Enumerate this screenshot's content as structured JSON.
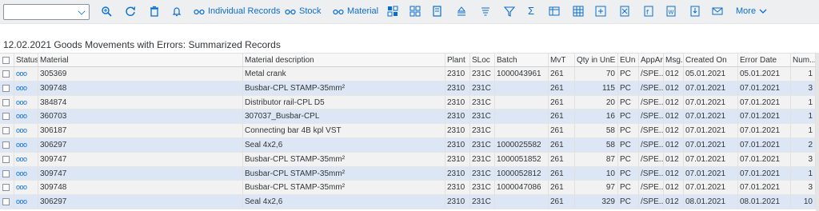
{
  "toolbar": {
    "variant_value": "",
    "individual_records": "Individual Records",
    "stock": "Stock",
    "material": "Material",
    "more": "More"
  },
  "title": "12.02.2021 Goods Movements with Errors: Summarized Records",
  "columns": [
    "Status",
    "Material",
    "Material description",
    "Plant",
    "SLoc",
    "Batch",
    "MvT",
    "Qty in UnE",
    "EUn",
    "AppAr",
    "Msg.",
    "Created On",
    "Error Date",
    "Num..."
  ],
  "rows": [
    {
      "status": "OOO",
      "material": "305369",
      "desc": "Metal crank",
      "plant": "2310",
      "sloc": "231C",
      "batch": "1000043961",
      "mvt": "261",
      "qty": "70",
      "eun": "PC",
      "appar": "/SPE...",
      "msg": "012",
      "created": "05.01.2021",
      "error": "05.01.2021",
      "num": "1"
    },
    {
      "status": "OOO",
      "material": "309748",
      "desc": "Busbar-CPL STAMP-35mm²",
      "plant": "2310",
      "sloc": "231C",
      "batch": "",
      "mvt": "261",
      "qty": "115",
      "eun": "PC",
      "appar": "/SPE...",
      "msg": "012",
      "created": "07.01.2021",
      "error": "07.01.2021",
      "num": "3"
    },
    {
      "status": "OOO",
      "material": "384874",
      "desc": "Distributor rail-CPL D5",
      "plant": "2310",
      "sloc": "231C",
      "batch": "",
      "mvt": "261",
      "qty": "20",
      "eun": "PC",
      "appar": "/SPE...",
      "msg": "012",
      "created": "07.01.2021",
      "error": "07.01.2021",
      "num": "1"
    },
    {
      "status": "OOO",
      "material": "360703",
      "desc": "307037_Busbar-CPL",
      "plant": "2310",
      "sloc": "231C",
      "batch": "",
      "mvt": "261",
      "qty": "16",
      "eun": "PC",
      "appar": "/SPE...",
      "msg": "012",
      "created": "07.01.2021",
      "error": "07.01.2021",
      "num": "1"
    },
    {
      "status": "OOO",
      "material": "306187",
      "desc": "Connecting bar 4B kpl VST",
      "plant": "2310",
      "sloc": "231C",
      "batch": "",
      "mvt": "261",
      "qty": "58",
      "eun": "PC",
      "appar": "/SPE...",
      "msg": "012",
      "created": "07.01.2021",
      "error": "07.01.2021",
      "num": "1"
    },
    {
      "status": "OOO",
      "material": "306297",
      "desc": "Seal 4x2,6",
      "plant": "2310",
      "sloc": "231C",
      "batch": "1000025582",
      "mvt": "261",
      "qty": "58",
      "eun": "PC",
      "appar": "/SPE...",
      "msg": "012",
      "created": "07.01.2021",
      "error": "07.01.2021",
      "num": "2"
    },
    {
      "status": "OOO",
      "material": "309747",
      "desc": "Busbar-CPL STAMP-35mm²",
      "plant": "2310",
      "sloc": "231C",
      "batch": "1000051852",
      "mvt": "261",
      "qty": "87",
      "eun": "PC",
      "appar": "/SPE...",
      "msg": "012",
      "created": "07.01.2021",
      "error": "07.01.2021",
      "num": "3"
    },
    {
      "status": "OOO",
      "material": "309747",
      "desc": "Busbar-CPL STAMP-35mm²",
      "plant": "2310",
      "sloc": "231C",
      "batch": "1000052812",
      "mvt": "261",
      "qty": "10",
      "eun": "PC",
      "appar": "/SPE...",
      "msg": "012",
      "created": "07.01.2021",
      "error": "07.01.2021",
      "num": "1"
    },
    {
      "status": "OOO",
      "material": "309748",
      "desc": "Busbar-CPL STAMP-35mm²",
      "plant": "2310",
      "sloc": "231C",
      "batch": "1000047086",
      "mvt": "261",
      "qty": "97",
      "eun": "PC",
      "appar": "/SPE...",
      "msg": "012",
      "created": "07.01.2021",
      "error": "07.01.2021",
      "num": "3"
    },
    {
      "status": "OOO",
      "material": "306297",
      "desc": "Seal 4x2,6",
      "plant": "2310",
      "sloc": "231C",
      "batch": "",
      "mvt": "261",
      "qty": "329",
      "eun": "PC",
      "appar": "/SPE...",
      "msg": "012",
      "created": "08.01.2021",
      "error": "08.01.2021",
      "num": "10"
    }
  ],
  "colors": {
    "accent": "#0a6ed1",
    "row_odd": "#f2f2f2",
    "row_even": "#dce6f4",
    "toolbar_bg": "#edeff0"
  }
}
